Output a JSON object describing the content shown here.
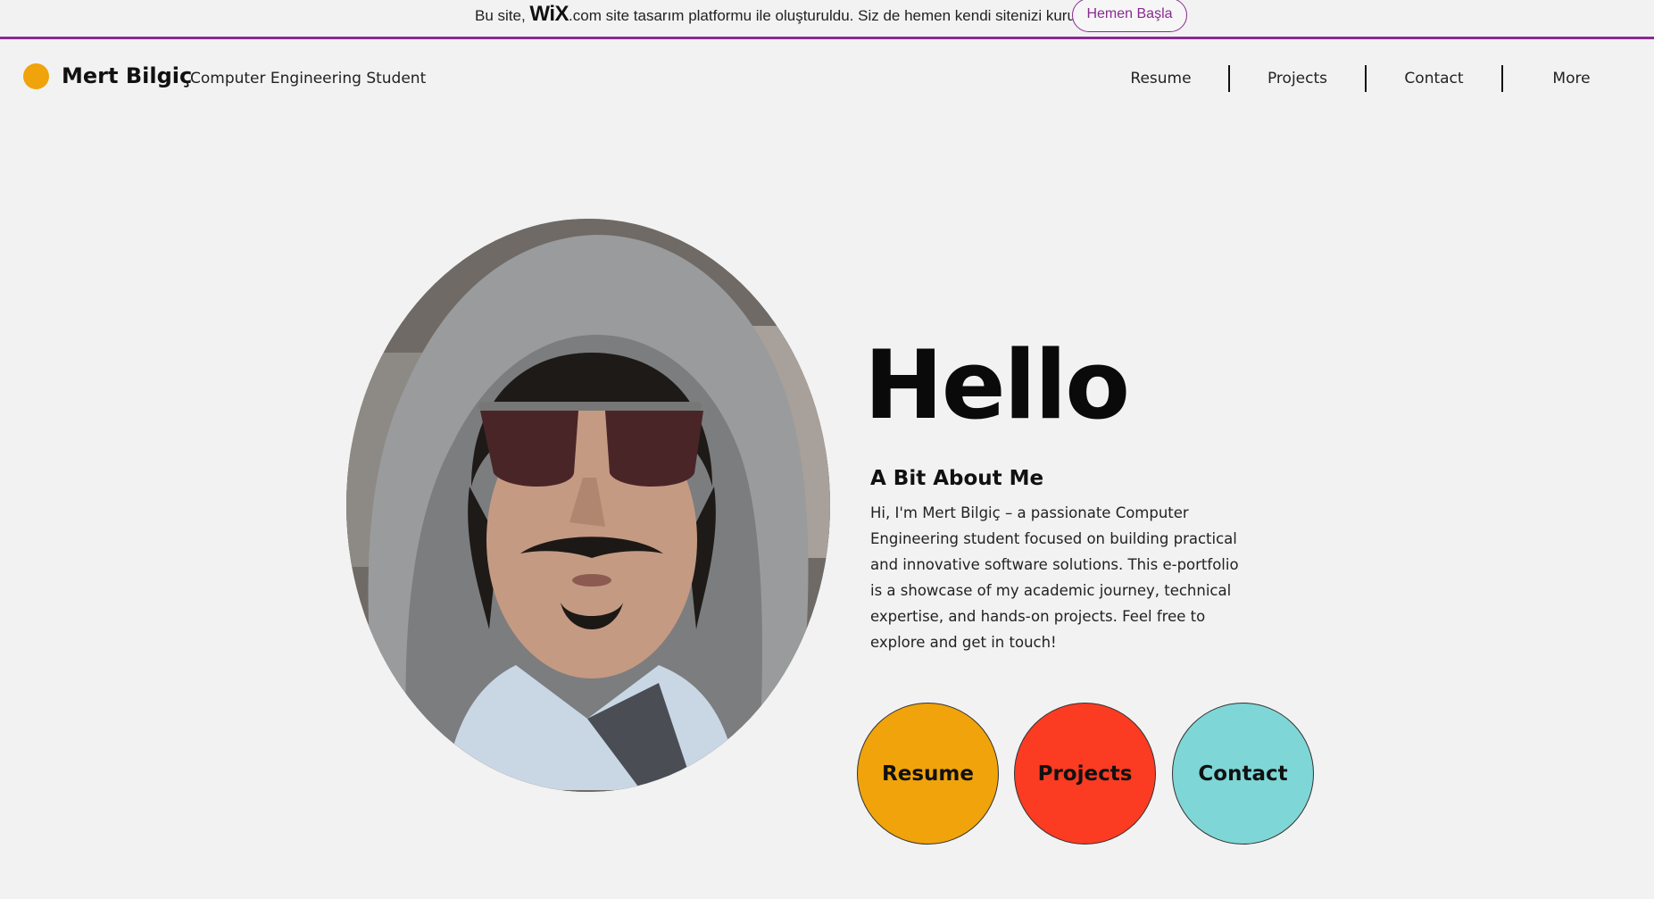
{
  "banner": {
    "text_before": "Bu site, ",
    "wix_logo": "WiX",
    "text_after": ".com site tasarım platformu ile oluşturuldu. Siz de hemen kendi sitenizi kurun.",
    "cta_label": "Hemen Başla",
    "accent_color": "#8a2a92"
  },
  "header": {
    "site_name": "Mert Bilgiç",
    "tagline": "Computer Engineering Student",
    "logo_color": "#f0a30a",
    "nav": [
      {
        "label": "Resume"
      },
      {
        "label": "Projects"
      },
      {
        "label": "Contact"
      },
      {
        "label": "More"
      }
    ]
  },
  "hero": {
    "greeting": "Hello",
    "about_heading": "A Bit About Me",
    "about_text": "Hi, I'm Mert Bilgiç – a passionate Computer Engineering student focused on building practical and innovative software solutions. This e-portfolio is a showcase of my academic journey, technical expertise, and hands-on projects. Feel free to explore and get in touch!",
    "buttons": [
      {
        "label": "Resume",
        "color": "#f0a30a"
      },
      {
        "label": "Projects",
        "color": "#fb3b22"
      },
      {
        "label": "Contact",
        "color": "#7fd6d6"
      }
    ]
  }
}
